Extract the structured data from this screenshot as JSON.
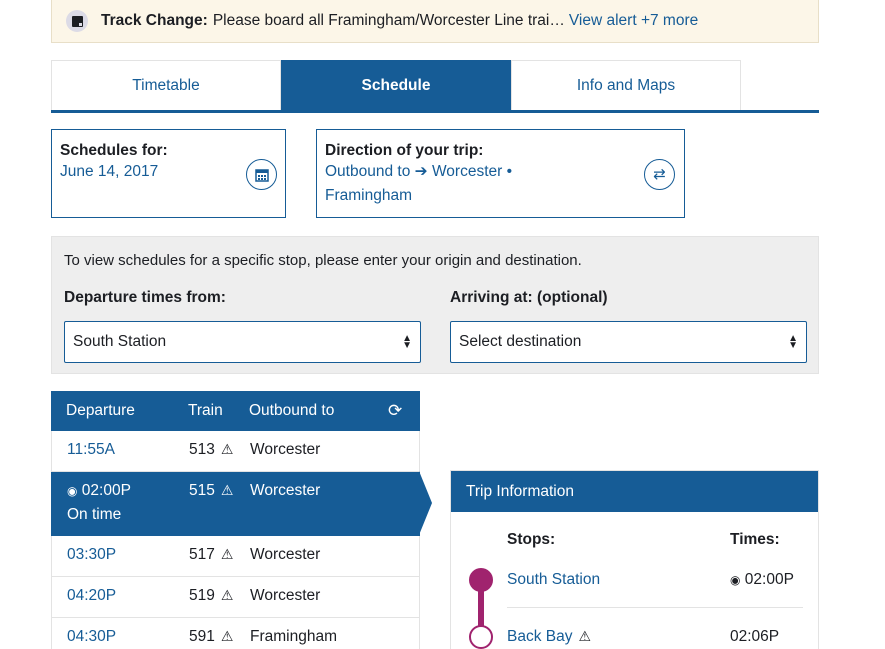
{
  "alert": {
    "title": "Track Change:",
    "message": "Please board all Framingham/Worcester Line trai…",
    "link": "View alert +7 more"
  },
  "tabs": [
    {
      "label": "Timetable",
      "active": false
    },
    {
      "label": "Schedule",
      "active": true
    },
    {
      "label": "Info and Maps",
      "active": false
    }
  ],
  "schedules_for": {
    "label": "Schedules for:",
    "date": "June 14, 2017"
  },
  "direction": {
    "label": "Direction of your trip:",
    "direction": "Outbound to",
    "destination": "Worcester •",
    "destination2": "Framingham"
  },
  "stop_panel": {
    "hint": "To view schedules for a specific stop, please enter your origin and destination.",
    "departure_label": "Departure times from:",
    "departure_value": "South Station",
    "arriving_label": "Arriving at: (optional)",
    "arriving_value": "Select destination"
  },
  "table": {
    "headers": [
      "Departure",
      "Train",
      "Outbound to"
    ],
    "rows": [
      {
        "time": "11:55A",
        "train": "513",
        "dest": "Worcester"
      },
      {
        "time": "02:00P",
        "status": "On time",
        "train": "515",
        "dest": "Worcester"
      },
      {
        "time": "03:30P",
        "train": "517",
        "dest": "Worcester"
      },
      {
        "time": "04:20P",
        "train": "519",
        "dest": "Worcester"
      },
      {
        "time": "04:30P",
        "train": "591",
        "dest": "Framingham"
      }
    ]
  },
  "trip": {
    "title": "Trip Information",
    "stops_label": "Stops:",
    "times_label": "Times:",
    "stops": [
      {
        "name": "South Station",
        "time": "02:00P"
      },
      {
        "name": "Back Bay",
        "time": "02:06P"
      }
    ]
  },
  "colors": {
    "primary": "#165c96",
    "line": "#a0236e",
    "alert_bg": "#fcf6e8"
  }
}
